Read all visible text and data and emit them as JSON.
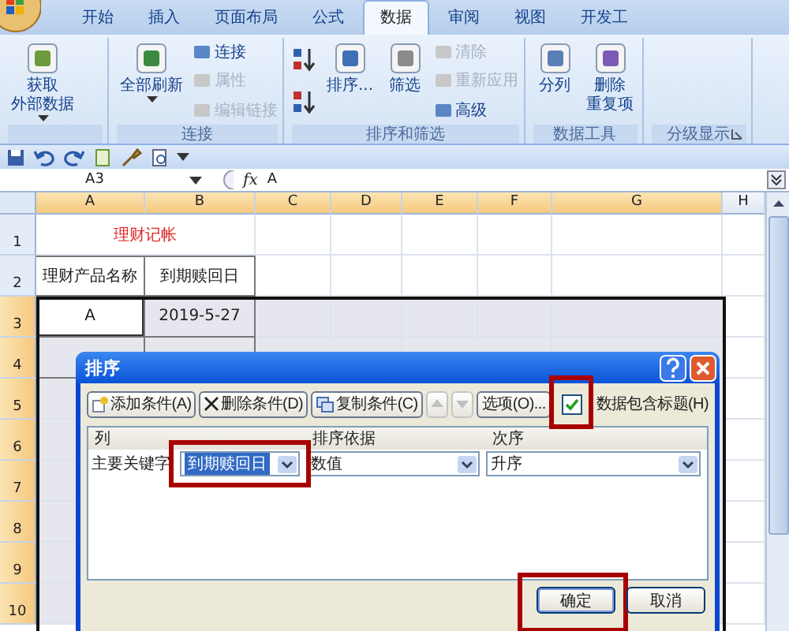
{
  "ribbon": {
    "tabs": [
      {
        "label": "开始",
        "selected": false
      },
      {
        "label": "插入",
        "selected": false
      },
      {
        "label": "页面布局",
        "selected": false
      },
      {
        "label": "公式",
        "selected": false
      },
      {
        "label": "数据",
        "selected": true
      },
      {
        "label": "审阅",
        "selected": false
      },
      {
        "label": "视图",
        "selected": false
      },
      {
        "label": "开发工",
        "selected": false
      }
    ],
    "groups": [
      {
        "items": [
          {
            "kind": "large",
            "lines": [
              "获取",
              "外部数据"
            ],
            "dropdown": true
          }
        ]
      },
      {
        "label": "连接",
        "items": [
          {
            "kind": "large",
            "lines": [
              "全部刷新"
            ],
            "dropdown": true
          },
          {
            "kind": "stack",
            "entries": [
              {
                "label": "连接",
                "disabled": false
              },
              {
                "label": "属性",
                "disabled": true
              },
              {
                "label": "编辑链接",
                "disabled": true
              }
            ]
          }
        ]
      },
      {
        "label": "排序和筛选",
        "items": [
          {
            "kind": "sort_buttons"
          },
          {
            "kind": "large",
            "lines": [
              "排序..."
            ],
            "dropdown": false
          },
          {
            "kind": "large",
            "lines": [
              "筛选"
            ],
            "dropdown": false
          },
          {
            "kind": "stack",
            "entries": [
              {
                "label": "清除",
                "disabled": true
              },
              {
                "label": "重新应用",
                "disabled": true
              },
              {
                "label": "高级",
                "disabled": false
              }
            ]
          }
        ]
      },
      {
        "label": "数据工具",
        "items": [
          {
            "kind": "large",
            "lines": [
              "分列"
            ],
            "dropdown": false
          },
          {
            "kind": "large",
            "lines": [
              "删除",
              "重复项"
            ],
            "dropdown": false
          }
        ]
      },
      {
        "label": "分级显示",
        "launcher": true
      }
    ]
  },
  "formula_bar": {
    "name_box": "A3",
    "function_label": "fx",
    "value": "A"
  },
  "sheet": {
    "columns": [
      {
        "label": "A",
        "selected": true
      },
      {
        "label": "B",
        "selected": true
      },
      {
        "label": "C",
        "selected": true
      },
      {
        "label": "D",
        "selected": true
      },
      {
        "label": "E",
        "selected": true
      },
      {
        "label": "F",
        "selected": true
      },
      {
        "label": "G",
        "selected": true
      },
      {
        "label": "H",
        "selected": false
      }
    ],
    "rows": [
      {
        "header": "1",
        "selected": false,
        "cells": [
          {
            "kind": "title",
            "text": "理财记帐",
            "merged": true
          }
        ]
      },
      {
        "header": "2",
        "selected": false,
        "cells": [
          {
            "kind": "header",
            "text": "理财产品名称"
          },
          {
            "kind": "header",
            "text": "到期赎回日"
          }
        ]
      },
      {
        "header": "3",
        "selected": true,
        "cells": [
          {
            "kind": "data",
            "text": "A",
            "active": true
          },
          {
            "kind": "data",
            "text": "2019-5-27",
            "active": false
          }
        ]
      },
      {
        "header": "4",
        "selected": true,
        "cells": [
          {
            "kind": "data",
            "active": false
          },
          {
            "kind": "data",
            "active": false
          }
        ]
      },
      {
        "header": "5",
        "selected": true
      },
      {
        "header": "6",
        "selected": true
      },
      {
        "header": "7",
        "selected": true
      },
      {
        "header": "8",
        "selected": true
      },
      {
        "header": "9",
        "selected": true
      },
      {
        "header": "10",
        "selected": true
      }
    ]
  },
  "dialog": {
    "title": "排序",
    "toolbar": [
      {
        "kind": "add",
        "label": "添加条件(A)"
      },
      {
        "kind": "delete",
        "label": "删除条件(D)"
      },
      {
        "kind": "copy",
        "label": "复制条件(C)"
      },
      {
        "kind": "up",
        "disabled": true
      },
      {
        "kind": "down",
        "disabled": true
      },
      {
        "kind": "options",
        "label": "选项(O)..."
      }
    ],
    "has_headers": {
      "label": "数据包含标题(H)",
      "checked": true,
      "highlighted": true
    },
    "columns": [
      "列",
      "排序依据",
      "次序"
    ],
    "levels": [
      {
        "label": "主要关键字",
        "column": "到期赎回日",
        "column_highlighted": true,
        "sort_on": "数值",
        "order": "升序"
      }
    ],
    "buttons": [
      {
        "label": "确定",
        "highlighted": true
      },
      {
        "label": "取消",
        "highlighted": false
      }
    ]
  }
}
